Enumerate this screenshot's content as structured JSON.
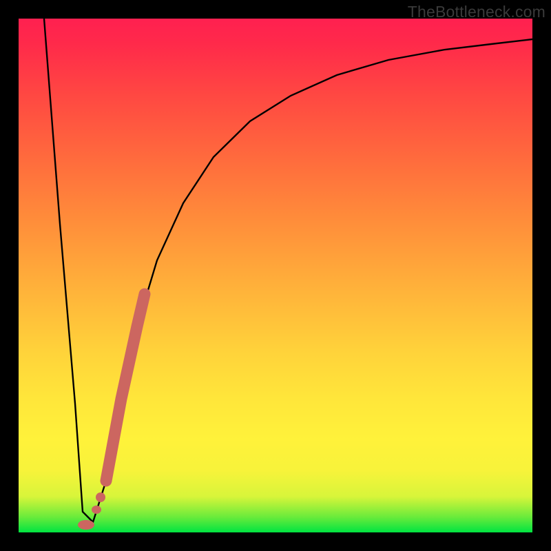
{
  "watermark": "TheBottleneck.com",
  "colors": {
    "curve_stroke": "#000000",
    "marker_fill": "#cc6660",
    "frame_bg": "#000000"
  },
  "chart_data": {
    "type": "line",
    "title": "",
    "xlabel": "",
    "ylabel": "",
    "xlim": [
      0,
      100
    ],
    "ylim": [
      0,
      100
    ],
    "series": [
      {
        "name": "bottleneck-curve",
        "x": [
          5,
          8,
          11,
          12.5,
          14.5,
          17,
          20,
          23,
          27,
          32,
          38,
          45,
          53,
          62,
          72,
          83,
          92,
          100
        ],
        "values": [
          100,
          60,
          25,
          4,
          2,
          10,
          26,
          40,
          53,
          64,
          73,
          80,
          85,
          89,
          92,
          94,
          95,
          96
        ]
      }
    ],
    "markers": [
      {
        "name": "highlight-segment",
        "x_range": [
          17,
          24.5
        ],
        "note": "thick salmon segment on rising limb"
      },
      {
        "name": "highlight-dot-1",
        "x": 15.5
      },
      {
        "name": "highlight-dot-2",
        "x": 14.5
      },
      {
        "name": "minimum-dot",
        "x": 13.0
      }
    ]
  }
}
